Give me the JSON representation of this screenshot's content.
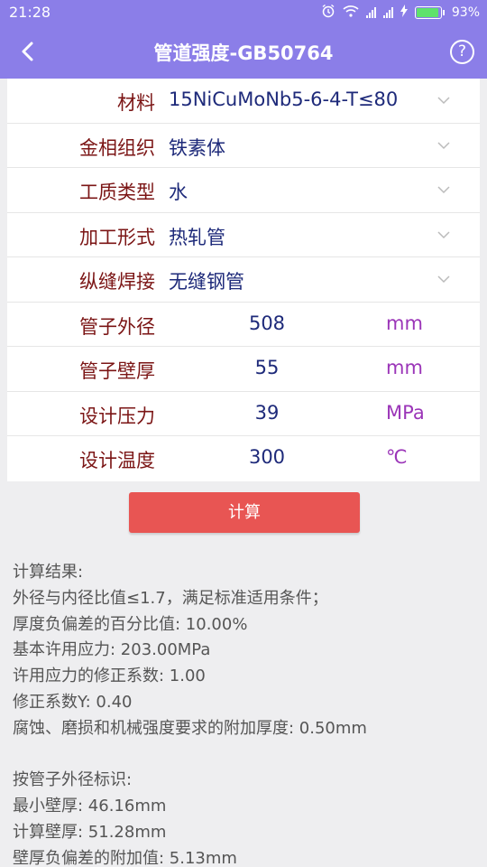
{
  "status": {
    "time": "21:28",
    "battery": "93%",
    "battery_level": 0.93
  },
  "header": {
    "back_icon": "arrow-left-icon",
    "title": "管道强度-GB50764",
    "help_icon": "question-circle-icon",
    "help_glyph": "?"
  },
  "colors": {
    "accent": "#8b7ee8",
    "label": "#7b1515",
    "value": "#1e2a7a",
    "unit": "#9b35b8",
    "button": "#e85553"
  },
  "form": {
    "material": {
      "label": "材料",
      "value": "15NiCuMoNb5-6-4-T≤80"
    },
    "phase": {
      "label": "金相组织",
      "value": "铁素体"
    },
    "medium": {
      "label": "工质类型",
      "value": "水"
    },
    "process": {
      "label": "加工形式",
      "value": "热轧管"
    },
    "weld": {
      "label": "纵缝焊接",
      "value": "无缝钢管"
    },
    "outer_diameter": {
      "label": "管子外径",
      "value": "508",
      "unit": "mm"
    },
    "wall_thickness": {
      "label": "管子壁厚",
      "value": "55",
      "unit": "mm"
    },
    "design_pressure": {
      "label": "设计压力",
      "value": "39",
      "unit": "MPa"
    },
    "design_temp": {
      "label": "设计温度",
      "value": "300",
      "unit": "℃"
    }
  },
  "calc_button": "计算",
  "results": {
    "lines": [
      "计算结果:",
      "外径与内径比值≤1.7，满足标准适用条件；",
      "厚度负偏差的百分比值: 10.00%",
      "基本许用应力: 203.00MPa",
      "许用应力的修正系数: 1.00",
      "修正系数Y: 0.40",
      "腐蚀、磨损和机械强度要求的附加厚度: 0.50mm"
    ],
    "lines2": [
      "按管子外径标识:",
      "最小壁厚: 46.16mm",
      "计算壁厚: 51.28mm",
      "壁厚负偏差的附加值: 5.13mm"
    ]
  }
}
